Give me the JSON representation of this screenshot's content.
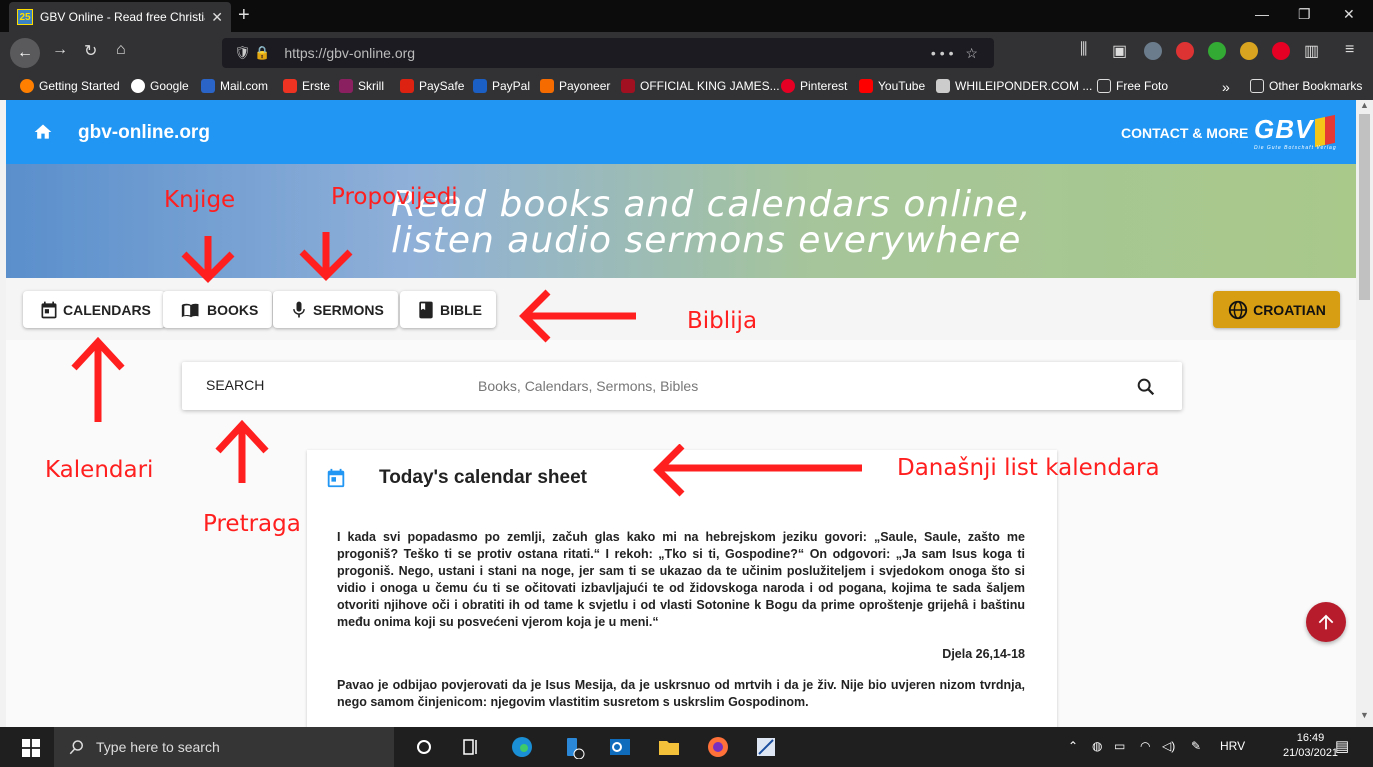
{
  "browser": {
    "tab_title": "GBV Online - Read free Christia",
    "tab_favicon": "25",
    "url": "https://gbv-online.org",
    "url_menu": "•••",
    "bookmarks": [
      "Getting Started",
      "Google",
      "Mail.com",
      "Erste",
      "Skrill",
      "PaySafe",
      "PayPal",
      "Payoneer",
      "OFFICIAL KING JAMES...",
      "Pinterest",
      "YouTube",
      "WHILEIPONDER.COM ...",
      "Free Foto"
    ],
    "overflow": "»",
    "other_bookmarks": "Other Bookmarks"
  },
  "site": {
    "name": "gbv-online.org",
    "contact": "CONTACT & MORE",
    "logo": "GBV",
    "logo_tag": "Die Gute Botschaft Verlag",
    "banner_line1": "Read books and calendars online,",
    "banner_line2": "listen audio sermons everywhere",
    "nav": {
      "calendars": "CALENDARS",
      "books": "BOOKS",
      "sermons": "SERMONS",
      "bible": "BIBLE"
    },
    "language": "CROATIAN",
    "search_label": "SEARCH",
    "search_placeholder": "Books, Calendars, Sermons, Bibles",
    "card_title": "Today's calendar sheet",
    "verse": "I kada svi popadasmo po zemlji, začuh glas kako mi na hebrejskom jeziku govori: „Saule, Saule, zašto me progoniš? Teško ti se protiv ostana ritati.“ I rekoh: „Tko si ti, Gospodine?“ On odgovori: „Ja sam Isus koga ti progoniš. Nego, ustani i stani na noge, jer sam ti se ukazao da te učinim poslužiteljem i svjedokom onoga što si vidio i onoga u čemu ću ti se očitovati izbavljajući te od židovskoga naroda i od pogana, kojima te sada šaljem otvoriti njihove oči i obratiti ih od tame k svjetlu i od vlasti Sotonine k Bogu da prime oproštenje grijehâ i baštinu među onima koji su posvećeni vjerom koja je u meni.“",
    "verse_ref": "Djela 26,14-18",
    "commentary": "Pavao je odbijao povjerovati da je Isus Mesija, da je uskrsnuo od mrtvih i da je živ. Nije bio uvjeren nizom tvrdnja, nego samom činjenicom: njegovim vlastitim susretom s uskrslim Gospodinom."
  },
  "annotations": {
    "knjige": "Knjige",
    "propovijedi": "Propovijedi",
    "biblija": "Biblija",
    "kalendari": "Kalendari",
    "pretraga": "Pretraga",
    "danasnji": "Današnji list kalendara"
  },
  "taskbar": {
    "search_placeholder": "Type here to search",
    "lang": "HRV",
    "time": "16:49",
    "date": "21/03/2021"
  },
  "colors": {
    "appbar": "#2196f3",
    "lang_button": "#d79d13",
    "fab": "#b71c2c",
    "annotation": "#ff1f1f"
  }
}
